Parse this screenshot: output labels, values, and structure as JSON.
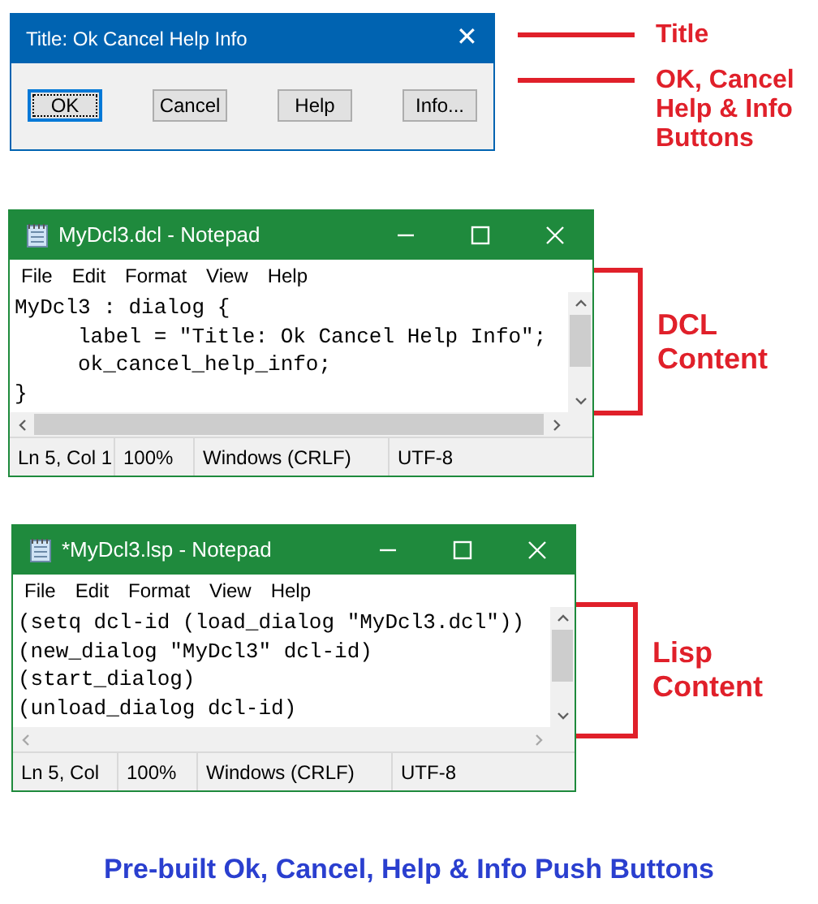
{
  "dialog": {
    "title": "Title: Ok Cancel Help Info",
    "close": "✕",
    "buttons": [
      {
        "label": "OK",
        "focused": true
      },
      {
        "label": "Cancel",
        "focused": false
      },
      {
        "label": "Help",
        "focused": false
      },
      {
        "label": "Info...",
        "focused": false
      }
    ]
  },
  "dialog_notes": [
    "Title",
    "OK, Cancel Help & Info Buttons"
  ],
  "notepads": [
    {
      "title": "MyDcl3.dcl - Notepad",
      "menu": [
        "File",
        "Edit",
        "Format",
        "View",
        "Help"
      ],
      "lines": [
        "MyDcl3 : dialog {",
        "     label = \"Title: Ok Cancel Help Info\";",
        "     ok_cancel_help_info;",
        "}"
      ],
      "hscroll_enabled": true,
      "status": [
        "Ln 5, Col 1",
        "100%",
        "Windows (CRLF)",
        "UTF-8"
      ],
      "note": "DCL Content"
    },
    {
      "title": "*MyDcl3.lsp - Notepad",
      "menu": [
        "File",
        "Edit",
        "Format",
        "View",
        "Help"
      ],
      "lines": [
        "(setq dcl-id (load_dialog \"MyDcl3.dcl\"))",
        "(new_dialog \"MyDcl3\" dcl-id)",
        "(start_dialog)",
        "(unload_dialog dcl-id)"
      ],
      "hscroll_enabled": false,
      "status": [
        "Ln 5, Col",
        "100%",
        "Windows (CRLF)",
        "UTF-8"
      ],
      "note": "Lisp Content"
    }
  ],
  "caption": "Pre-built Ok, Cancel, Help & Info Push Buttons"
}
